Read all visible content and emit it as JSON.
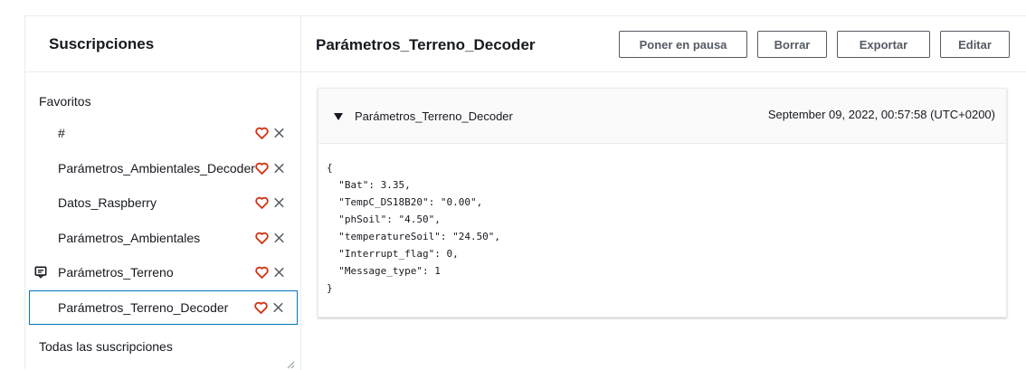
{
  "sidebar": {
    "title": "Suscripciones",
    "favorites_label": "Favoritos",
    "items": [
      {
        "label": "#",
        "selected": false,
        "pinned": false
      },
      {
        "label": "Parámetros_Ambientales_Decoder",
        "selected": false,
        "pinned": false
      },
      {
        "label": "Datos_Raspberry",
        "selected": false,
        "pinned": false
      },
      {
        "label": "Parámetros_Ambientales",
        "selected": false,
        "pinned": false
      },
      {
        "label": "Parámetros_Terreno",
        "selected": false,
        "pinned": true
      },
      {
        "label": "Parámetros_Terreno_Decoder",
        "selected": true,
        "pinned": false
      }
    ],
    "all_label": "Todas las suscripciones"
  },
  "main": {
    "topic_title": "Parámetros_Terreno_Decoder",
    "buttons": {
      "pause": "Poner en pausa",
      "delete": "Borrar",
      "export": "Exportar",
      "edit": "Editar"
    },
    "message": {
      "topic": "Parámetros_Terreno_Decoder",
      "timestamp": "September 09, 2022, 00:57:58 (UTC+0200)",
      "payload": "{\n  \"Bat\": 3.35,\n  \"TempC_DS18B20\": \"0.00\",\n  \"phSoil\": \"4.50\",\n  \"temperatureSoil\": \"24.50\",\n  \"Interrupt_flag\": 0,\n  \"Message_type\": 1\n}"
    }
  },
  "colors": {
    "favorite_heart": "#d13212",
    "selected_border": "#0073bb",
    "button_text": "#545b64",
    "divider": "#eaeded"
  },
  "icons": {
    "favorite": "heart-icon",
    "remove": "close-icon",
    "pinned": "message-icon",
    "expand": "caret-down-icon"
  }
}
